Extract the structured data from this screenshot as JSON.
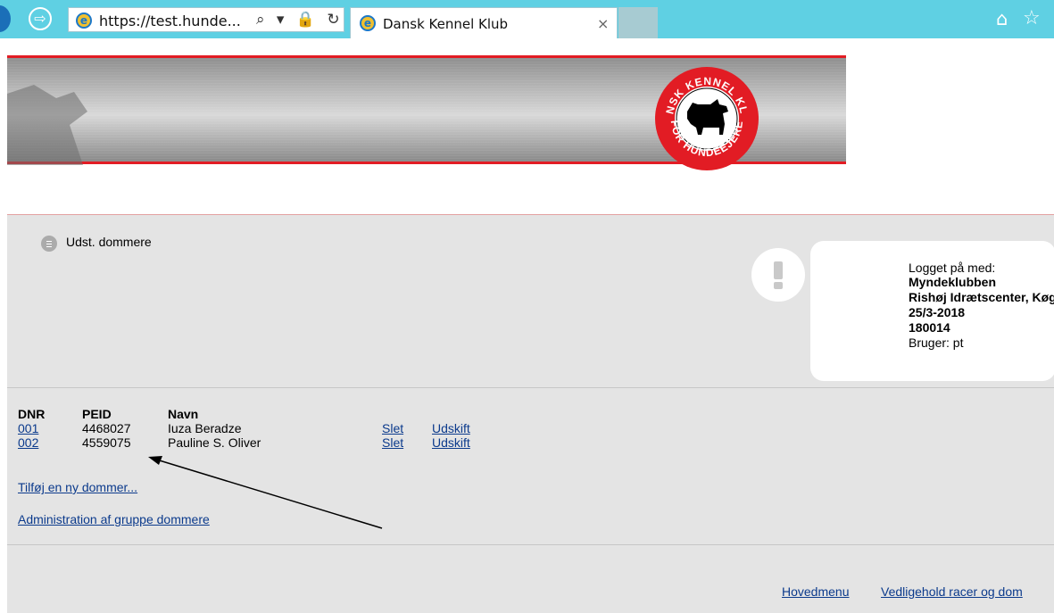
{
  "browser": {
    "url_display": "https://test.hunde...",
    "tab_title": "Dansk Kennel Klub",
    "tab_close": "×",
    "forward_icon": "arrow-right-icon",
    "home_icon": "home-icon",
    "favorites_icon": "star-icon",
    "addr_tools": "⌕ ▾ 🔒 ↻"
  },
  "banner": {
    "logo_top_text": "DANSK KENNEL KLUB",
    "logo_bottom_text": "FOR HUNDEEJERE",
    "accent_color": "#e21c24"
  },
  "nav": {
    "page_label": "Udst. dommere"
  },
  "info": {
    "line1": "Logget på med:",
    "club": "Myndeklubben",
    "venue": "Rishøj Idrætscenter, Køge",
    "date": "25/3-2018",
    "show_id": "180014",
    "user": "Bruger: pt"
  },
  "table": {
    "headers": [
      "DNR",
      "PEID",
      "Navn"
    ],
    "rows": [
      {
        "dnr": "001",
        "peid": "4468027",
        "navn": "Iuza Beradze",
        "delete": "Slet",
        "replace": "Udskift"
      },
      {
        "dnr": "002",
        "peid": "4559075",
        "navn": "Pauline S. Oliver",
        "delete": "Slet",
        "replace": "Udskift"
      }
    ]
  },
  "actions": {
    "add_judge": "Tilføj en ny dommer...",
    "group_admin": "Administration af gruppe dommere"
  },
  "footer": {
    "main_menu": "Hovedmenu",
    "maintain": "Vedligehold racer og dom"
  }
}
